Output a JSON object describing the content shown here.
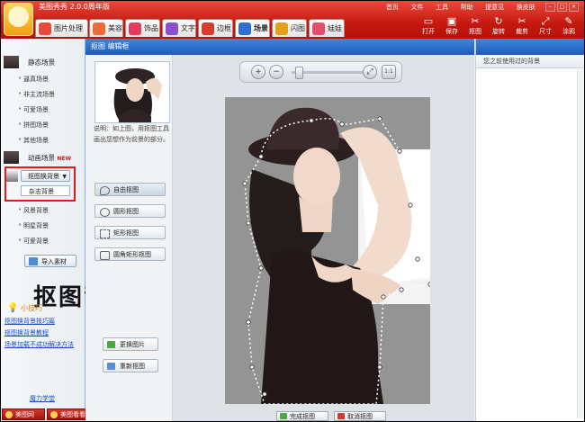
{
  "app": {
    "title": "美图秀秀 2.0.0周年版",
    "title_menus": [
      "首页",
      "文件",
      "工具",
      "帮助",
      "提意见",
      "换皮肤"
    ],
    "window_controls": [
      "–",
      "□",
      "×"
    ]
  },
  "tabs": [
    {
      "label": "图片处理",
      "color": "#e94a3b"
    },
    {
      "label": "美容",
      "color": "#f06a3a"
    },
    {
      "label": "饰品",
      "color": "#e33b5e"
    },
    {
      "label": "文字",
      "color": "#8b4fcf"
    },
    {
      "label": "边框",
      "color": "#d43c2e"
    },
    {
      "label": "场景",
      "color": "#2f6fd0"
    },
    {
      "label": "闪图",
      "color": "#e0a01e"
    },
    {
      "label": "娃娃",
      "color": "#e0506b"
    }
  ],
  "active_tab": "场景",
  "toolbar": {
    "tools": [
      {
        "label": "打开",
        "icon": "folder-icon"
      },
      {
        "label": "保存",
        "icon": "save-icon"
      },
      {
        "label": "抠图",
        "icon": "cutout-icon"
      },
      {
        "label": "旋转",
        "icon": "rotate-icon"
      },
      {
        "label": "裁剪",
        "icon": "crop-icon"
      },
      {
        "label": "尺寸",
        "icon": "resize-icon"
      },
      {
        "label": "涂鸦",
        "icon": "brush-icon"
      }
    ]
  },
  "sidebar": {
    "categories": {
      "static": "静态场景",
      "animated": "动画场景",
      "animated_badge": "NEW",
      "cutout": "抠图换背景",
      "selected": "杂志背景"
    },
    "static_items": [
      "逼真场景",
      "非主流场景",
      "可爱场景",
      "拼图场景",
      "其他场景"
    ],
    "cutout_items": [
      "风景背景",
      "明星背景",
      "可爱背景"
    ],
    "import_label": "导入素材",
    "overlay_caption": "抠图背景",
    "tips_title": "小技巧",
    "tip_links": [
      "抠图换背景技巧篇",
      "抠图换背景教程",
      "场景加载不成功解决方法"
    ],
    "more_link": "魔力学堂",
    "bottom_buttons": [
      "美图网",
      "美图看看"
    ]
  },
  "editor": {
    "header": "抠图   编辑框",
    "description": "说明：如上图，用抠图工具画出您想作为前景的部分。",
    "modes": [
      "自由抠图",
      "圆形抠图",
      "矩形抠图",
      "圆角矩形抠图"
    ],
    "actions": [
      "更换图片",
      "重新抠图"
    ],
    "zoom": {
      "zoom_in": "+",
      "zoom_out": "−",
      "fit": "⤢",
      "actual": "1:1",
      "level": 0.1
    },
    "canvas_buttons": [
      "完成抠图",
      "取消抠图"
    ]
  },
  "right_panel": {
    "header": "您之前使用过的背景"
  },
  "colors": {
    "brand_red": "#c5180f",
    "highlight_red": "#e21a1a",
    "header_blue": "#1f5cb6",
    "link_blue": "#1a4fc2"
  }
}
